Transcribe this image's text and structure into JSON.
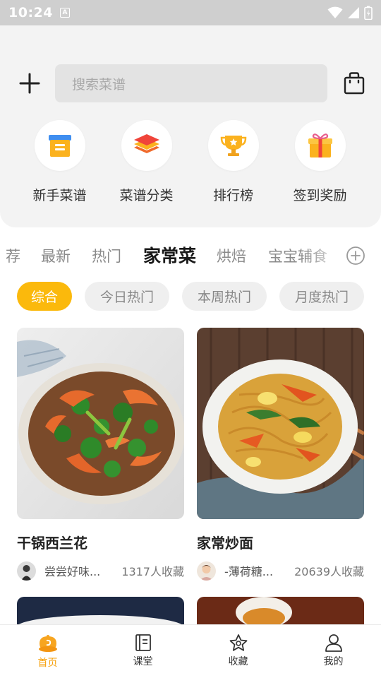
{
  "status_bar": {
    "time": "10:24"
  },
  "search": {
    "placeholder": "搜索菜谱"
  },
  "categories": [
    {
      "label": "新手菜谱",
      "icon": "box-icon"
    },
    {
      "label": "菜谱分类",
      "icon": "layers-icon"
    },
    {
      "label": "排行榜",
      "icon": "trophy-icon"
    },
    {
      "label": "签到奖励",
      "icon": "gift-icon"
    }
  ],
  "tabs": [
    "荐",
    "最新",
    "热门",
    "家常菜",
    "烘焙",
    "宝宝辅食"
  ],
  "active_tab": "家常菜",
  "filters": [
    "综合",
    "今日热门",
    "本周热门",
    "月度热门"
  ],
  "active_filter": "综合",
  "recipes": [
    {
      "title": "干锅西兰花",
      "author": "尝尝好味...",
      "favorites": "1317人收藏"
    },
    {
      "title": "家常炒面",
      "author": "-薄荷糖...",
      "favorites": "20639人收藏"
    }
  ],
  "bottom_nav": [
    {
      "label": "首页",
      "icon": "home-icon"
    },
    {
      "label": "课堂",
      "icon": "book-icon"
    },
    {
      "label": "收藏",
      "icon": "star-icon"
    },
    {
      "label": "我的",
      "icon": "user-icon"
    }
  ],
  "colors": {
    "accent": "#fbb90c",
    "nav_active": "#f6a20f",
    "header_bg": "#f3f3f3"
  }
}
